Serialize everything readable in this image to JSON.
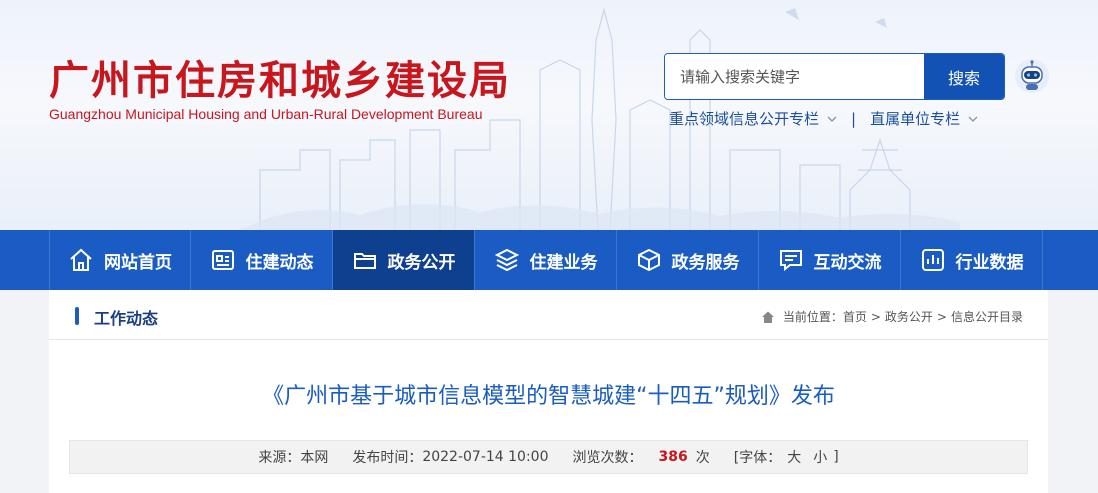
{
  "header": {
    "title": "广州市住房和城乡建设局",
    "subtitle": "Guangzhou Municipal Housing and Urban-Rural Development Bureau",
    "search_placeholder": "请输入搜索关键字",
    "search_button": "搜索",
    "quick_links": [
      "重点领域信息公开专栏",
      "直属单位专栏"
    ],
    "separator": "|"
  },
  "nav": {
    "items": [
      {
        "label": "网站首页",
        "icon": "home-icon"
      },
      {
        "label": "住建动态",
        "icon": "news-icon"
      },
      {
        "label": "政务公开",
        "icon": "folder-icon"
      },
      {
        "label": "住建业务",
        "icon": "layers-icon"
      },
      {
        "label": "政务服务",
        "icon": "box-icon"
      },
      {
        "label": "互动交流",
        "icon": "chat-icon"
      },
      {
        "label": "行业数据",
        "icon": "chart-icon"
      }
    ],
    "active_index": 2
  },
  "section": {
    "title": "工作动态",
    "breadcrumb_prefix": "当前位置：",
    "breadcrumb": [
      "首页",
      "政务公开",
      "信息公开目录"
    ],
    "breadcrumb_sep": ">"
  },
  "article": {
    "title": "《广州市基于城市信息模型的智慧城建“十四五”规划》发布",
    "source_label": "来源：",
    "source": "本网",
    "time_label": "发布时间：",
    "time": "2022-07-14 10:00",
    "views_label": "浏览次数：",
    "views": "386",
    "views_unit": "次",
    "font_label": "[字体：",
    "font_large": "大",
    "font_small": "小",
    "font_close": "]"
  },
  "colors": {
    "brand_red": "#c8161d",
    "nav_blue": "#1a5cc3",
    "nav_active": "#0f3f8f"
  }
}
